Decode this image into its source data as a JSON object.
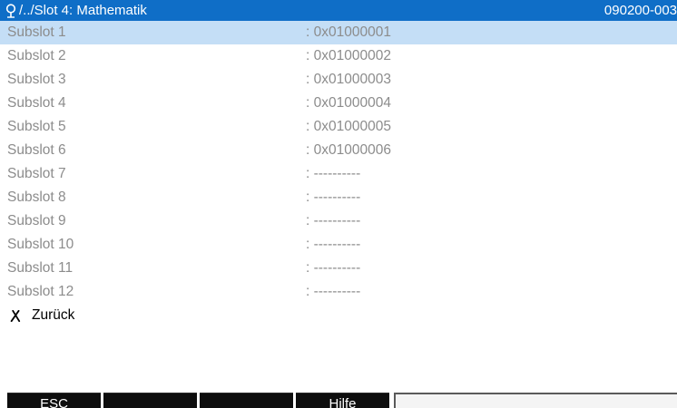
{
  "title": {
    "icon": "network-plug-icon",
    "path": "/../Slot 4: Mathematik",
    "code": "090200-003"
  },
  "subslots": [
    {
      "label": "Subslot 1",
      "value": ": 0x01000001",
      "selected": true
    },
    {
      "label": "Subslot 2",
      "value": ": 0x01000002"
    },
    {
      "label": "Subslot 3",
      "value": ": 0x01000003"
    },
    {
      "label": "Subslot 4",
      "value": ": 0x01000004"
    },
    {
      "label": "Subslot 5",
      "value": ": 0x01000005"
    },
    {
      "label": "Subslot 6",
      "value": ": 0x01000006"
    },
    {
      "label": "Subslot 7",
      "value": ": ----------"
    },
    {
      "label": "Subslot 8",
      "value": ": ----------"
    },
    {
      "label": "Subslot 9",
      "value": ": ----------"
    },
    {
      "label": "Subslot 10",
      "value": ": ----------"
    },
    {
      "label": "Subslot 11",
      "value": ": ----------"
    },
    {
      "label": "Subslot 12",
      "value": ": ----------"
    }
  ],
  "back": {
    "icon": "x-icon",
    "label": "Zurück"
  },
  "softkeys": [
    {
      "label": "ESC"
    },
    {
      "label": ""
    },
    {
      "label": ""
    },
    {
      "label": "Hilfe"
    },
    {
      "label": ""
    }
  ],
  "colors": {
    "title_bar": "#0f6ec7",
    "selection": "#c4def6",
    "inactive_text": "#8c8c8c",
    "softkey": "#0d0d0d"
  }
}
